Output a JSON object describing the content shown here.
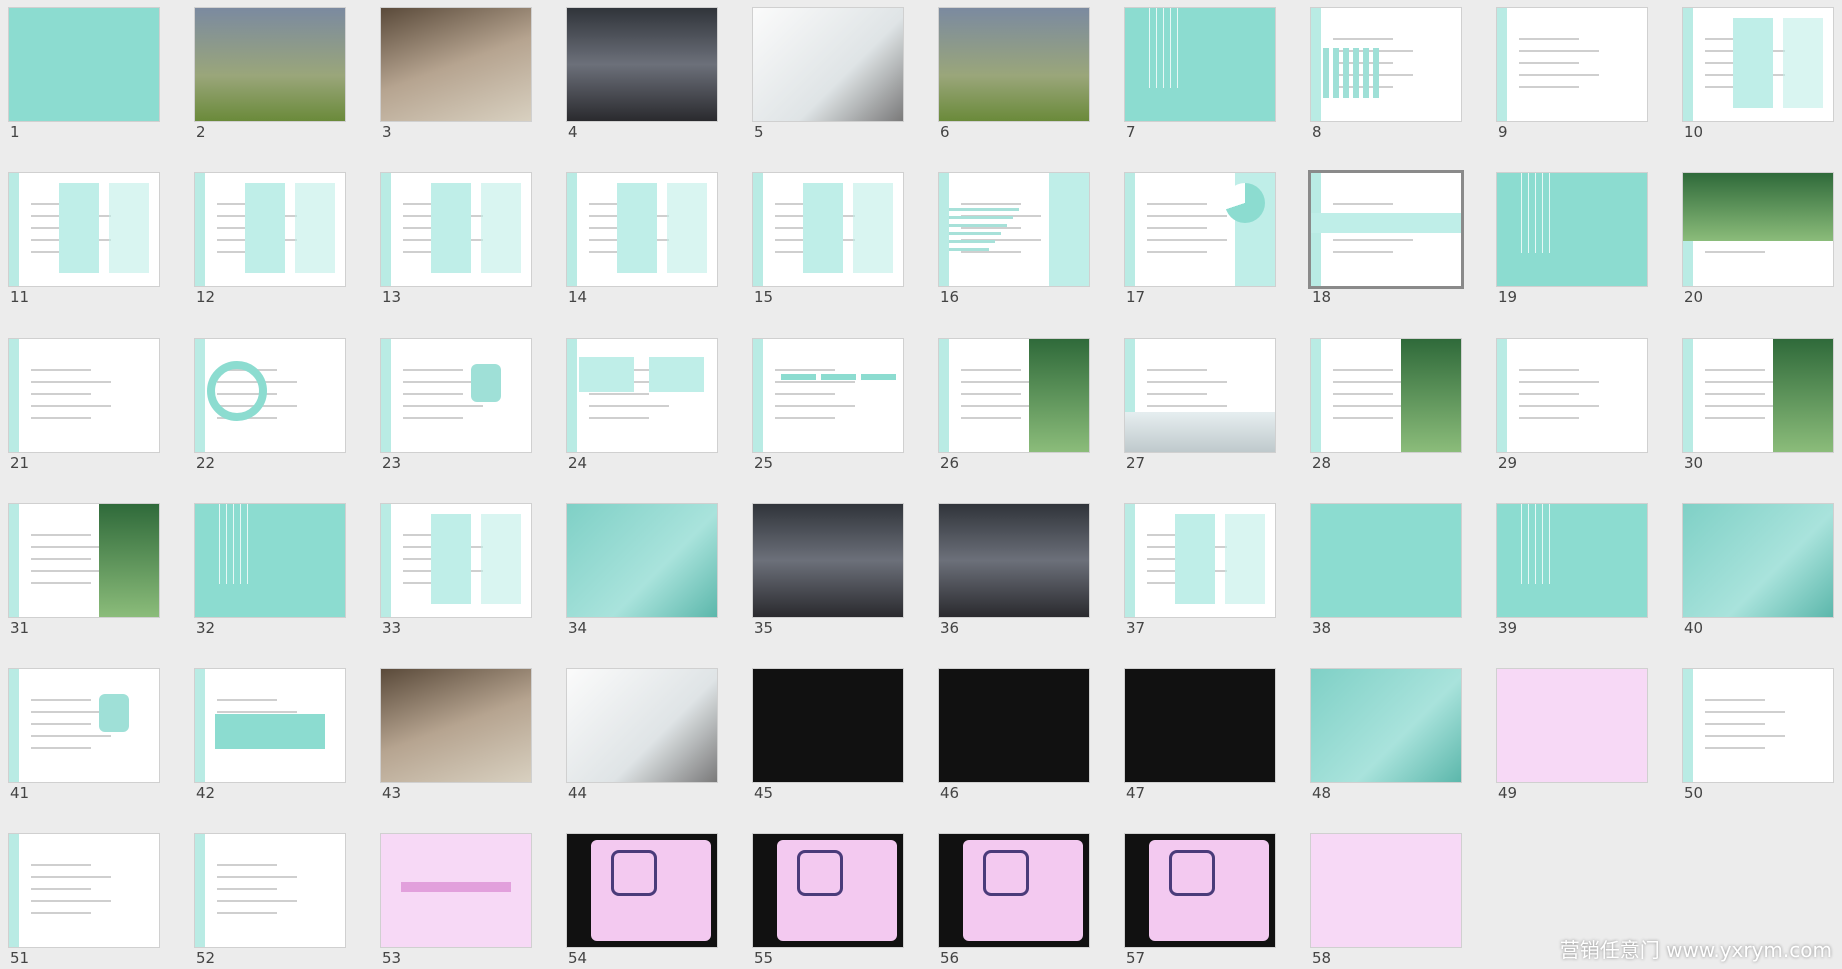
{
  "view": "slide_sorter",
  "selected_slide": 18,
  "watermark": "营销任意门 www.yxrym.com",
  "colors": {
    "theme_teal": "#8cdcd0",
    "theme_pink": "#f7d9f6",
    "background": "#ececec"
  },
  "slides": [
    {
      "number": "1",
      "kind": "teal"
    },
    {
      "number": "2",
      "kind": "photo"
    },
    {
      "number": "3",
      "kind": "photo2"
    },
    {
      "number": "4",
      "kind": "photo3"
    },
    {
      "number": "5",
      "kind": "photo4"
    },
    {
      "number": "6",
      "kind": "photo"
    },
    {
      "number": "7",
      "kind": "teal-strings"
    },
    {
      "number": "8",
      "kind": "white-bars"
    },
    {
      "number": "9",
      "kind": "white-list"
    },
    {
      "number": "10",
      "kind": "white-table"
    },
    {
      "number": "11",
      "kind": "white-table"
    },
    {
      "number": "12",
      "kind": "white-table"
    },
    {
      "number": "13",
      "kind": "white-table"
    },
    {
      "number": "14",
      "kind": "white-table"
    },
    {
      "number": "15",
      "kind": "white-table"
    },
    {
      "number": "16",
      "kind": "white-hbars"
    },
    {
      "number": "17",
      "kind": "white-pie"
    },
    {
      "number": "18",
      "kind": "white-band"
    },
    {
      "number": "19",
      "kind": "teal-strings"
    },
    {
      "number": "20",
      "kind": "white-photo"
    },
    {
      "number": "21",
      "kind": "white-text"
    },
    {
      "number": "22",
      "kind": "white-circle"
    },
    {
      "number": "23",
      "kind": "white-cup"
    },
    {
      "number": "24",
      "kind": "white-panels"
    },
    {
      "number": "25",
      "kind": "white-arrows"
    },
    {
      "number": "26",
      "kind": "white-photo-right"
    },
    {
      "number": "27",
      "kind": "white-photo-bottom"
    },
    {
      "number": "28",
      "kind": "white-photo-right"
    },
    {
      "number": "29",
      "kind": "white-text"
    },
    {
      "number": "30",
      "kind": "white-photo-right"
    },
    {
      "number": "31",
      "kind": "white-photo-right"
    },
    {
      "number": "32",
      "kind": "teal-strings"
    },
    {
      "number": "33",
      "kind": "white-table"
    },
    {
      "number": "34",
      "kind": "teal-photo"
    },
    {
      "number": "35",
      "kind": "photo3"
    },
    {
      "number": "36",
      "kind": "photo3"
    },
    {
      "number": "37",
      "kind": "white-table"
    },
    {
      "number": "38",
      "kind": "teal"
    },
    {
      "number": "39",
      "kind": "teal-strings"
    },
    {
      "number": "40",
      "kind": "teal-photo"
    },
    {
      "number": "41",
      "kind": "white-cup"
    },
    {
      "number": "42",
      "kind": "white-teal-strip"
    },
    {
      "number": "43",
      "kind": "photo2"
    },
    {
      "number": "44",
      "kind": "photo4"
    },
    {
      "number": "45",
      "kind": "black"
    },
    {
      "number": "46",
      "kind": "black"
    },
    {
      "number": "47",
      "kind": "black"
    },
    {
      "number": "48",
      "kind": "teal-photo"
    },
    {
      "number": "49",
      "kind": "pink"
    },
    {
      "number": "50",
      "kind": "white-text"
    },
    {
      "number": "51",
      "kind": "white-text"
    },
    {
      "number": "52",
      "kind": "white-text"
    },
    {
      "number": "53",
      "kind": "pink-center"
    },
    {
      "number": "54",
      "kind": "black-sticker"
    },
    {
      "number": "55",
      "kind": "black-sticker"
    },
    {
      "number": "56",
      "kind": "black-sticker"
    },
    {
      "number": "57",
      "kind": "black-sticker"
    },
    {
      "number": "58",
      "kind": "pink"
    }
  ]
}
